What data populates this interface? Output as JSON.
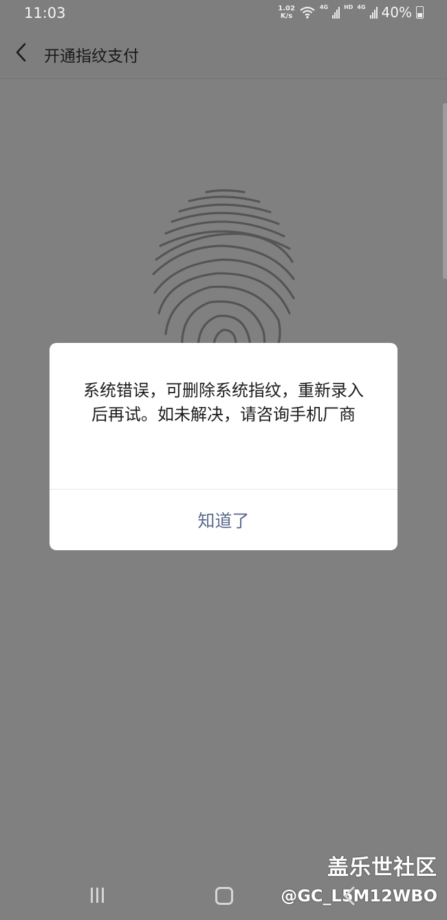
{
  "status_bar": {
    "time": "11:03",
    "net_speed_value": "1.02",
    "net_speed_unit": "K/s",
    "signal_label_1": "4G",
    "hd_label": "HD",
    "signal_label_2": "4G",
    "battery_percent": "40%"
  },
  "header": {
    "title": "开通指纹支付"
  },
  "dialog": {
    "message": "系统错误，可删除系统指纹，重新录入后再试。如未解决，请咨询手机厂商",
    "confirm_label": "知道了"
  },
  "watermark": {
    "name": "盖乐世社区",
    "user": "@GC_L5M12WBO"
  },
  "colors": {
    "background": "#808080",
    "dialog_button": "#5b6b8c",
    "fingerprint": "#555555"
  }
}
